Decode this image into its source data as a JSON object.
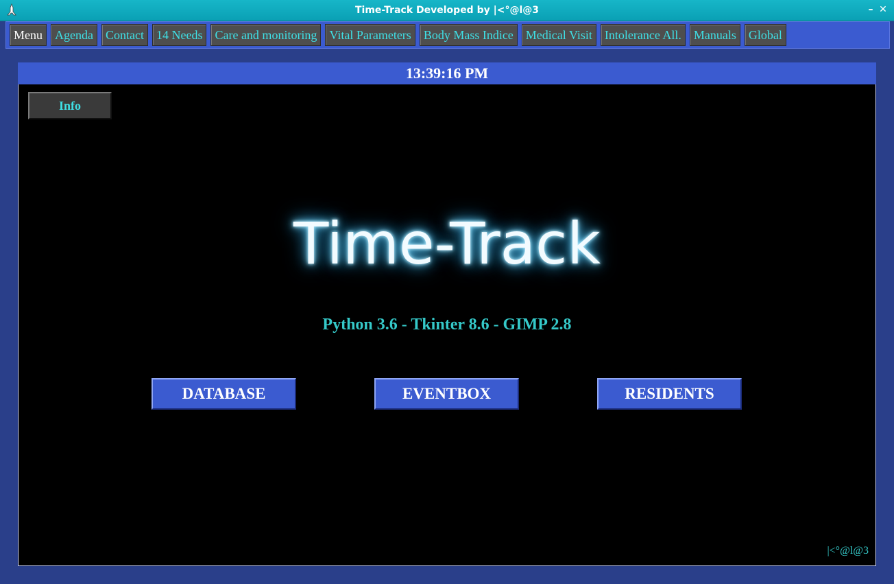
{
  "window": {
    "title": "Time-Track Developed by |<°@l@3",
    "minimize_glyph": "–",
    "close_glyph": "✕"
  },
  "menubar": {
    "items": [
      {
        "label": "Menu"
      },
      {
        "label": "Agenda"
      },
      {
        "label": "Contact"
      },
      {
        "label": "14 Needs"
      },
      {
        "label": "Care and monitoring"
      },
      {
        "label": "Vital Parameters"
      },
      {
        "label": "Body Mass Indice"
      },
      {
        "label": "Medical Visit"
      },
      {
        "label": "Intolerance All."
      },
      {
        "label": "Manuals"
      },
      {
        "label": "Global"
      }
    ]
  },
  "clock": {
    "time": "13:39:16 PM"
  },
  "main": {
    "info_label": "Info",
    "logo_text": "Time-Track",
    "version_text": "Python 3.6 - Tkinter 8.6 - GIMP 2.8",
    "buttons": {
      "database": "DATABASE",
      "eventbox": "EVENTBOX",
      "residents": "RESIDENTS"
    },
    "signature": "|<°@l@3"
  },
  "colors": {
    "accent_blue": "#3b5bd0",
    "cyan_text": "#3fe0e6",
    "titlebar": "#17b6c8",
    "background": "#2a3f8a"
  }
}
